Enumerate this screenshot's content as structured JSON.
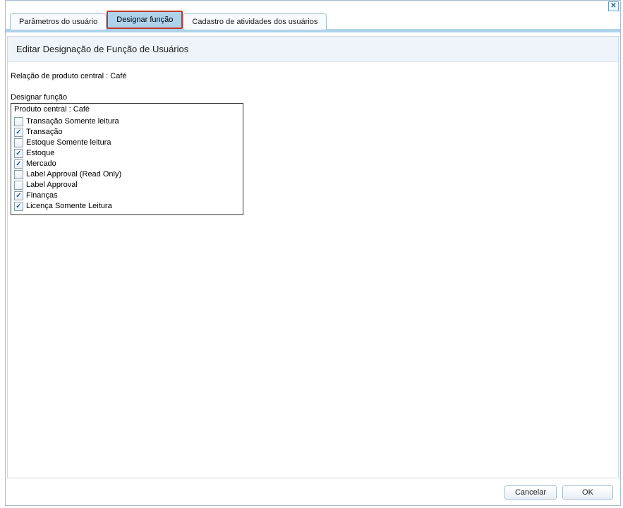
{
  "tabs": [
    {
      "label": "Parâmetros do usuário"
    },
    {
      "label": "Designar função"
    },
    {
      "label": "Cadastro de atividades dos usuários"
    }
  ],
  "section_title": "Editar Designação de Função de Usuários",
  "relation_line": "Relação de produto central : Café",
  "assign_label": "Designar função",
  "rolebox_title": "Produto central : Café",
  "roles": [
    {
      "label": "Transação Somente leitura",
      "checked": false
    },
    {
      "label": "Transação",
      "checked": true
    },
    {
      "label": "Estoque Somente leitura",
      "checked": false
    },
    {
      "label": "Estoque",
      "checked": true
    },
    {
      "label": "Mercado",
      "checked": true
    },
    {
      "label": "Label Approval (Read Only)",
      "checked": false
    },
    {
      "label": "Label Approval",
      "checked": false
    },
    {
      "label": "Finanças",
      "checked": true
    },
    {
      "label": "Licença Somente Leitura",
      "checked": true
    }
  ],
  "buttons": {
    "cancel": "Cancelar",
    "ok": "OK"
  },
  "close_glyph": "✕"
}
